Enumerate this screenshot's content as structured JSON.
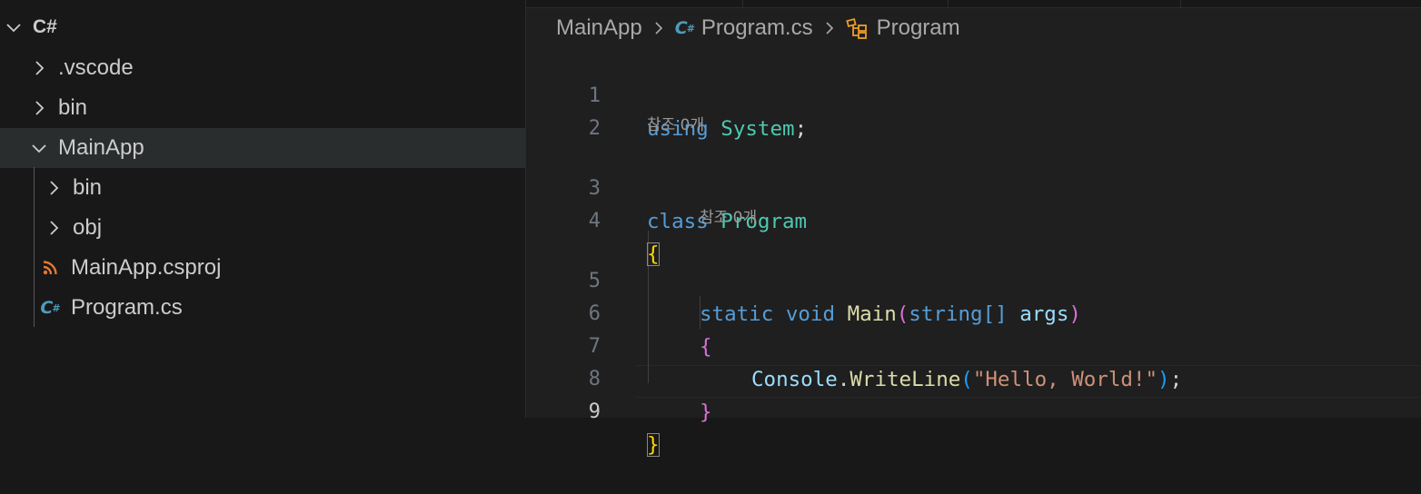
{
  "explorer": {
    "root": "C#",
    "items": [
      {
        "label": ".vscode",
        "kind": "folder",
        "expanded": false
      },
      {
        "label": "bin",
        "kind": "folder",
        "expanded": false
      },
      {
        "label": "MainApp",
        "kind": "folder",
        "expanded": true,
        "selected": true
      },
      {
        "label": "bin",
        "kind": "folder",
        "expanded": false
      },
      {
        "label": "obj",
        "kind": "folder",
        "expanded": false
      },
      {
        "label": "MainApp.csproj",
        "kind": "file",
        "icon": "rss-icon"
      },
      {
        "label": "Program.cs",
        "kind": "file",
        "icon": "csharp-icon",
        "icon_text": "C#"
      }
    ]
  },
  "breadcrumb": {
    "folder": "MainApp",
    "file": "Program.cs",
    "symbol": "Program",
    "file_icon_text": "C#"
  },
  "editor": {
    "line_numbers": [
      "1",
      "2",
      "3",
      "4",
      "5",
      "6",
      "7",
      "8",
      "9"
    ],
    "active_line": "9",
    "codelens": [
      "참조 0개",
      "참조 0개"
    ],
    "tokens": {
      "l1_kw": "using",
      "l1_ns": "System",
      "l1_end": ";",
      "l3_kw": "class",
      "l3_ty": "Program",
      "l4_br": "{",
      "l5_kw1": "static",
      "l5_kw2": "void",
      "l5_fn": "Main",
      "l5_open": "(",
      "l5_kw3": "string[]",
      "l5_var": "args",
      "l5_close": ")",
      "l6_br": "{",
      "l7_var": "Console",
      "l7_dot": ".",
      "l7_fn": "WriteLine",
      "l7_open": "(",
      "l7_str": "\"Hello, World!\"",
      "l7_close": ")",
      "l7_end": ";",
      "l8_br": "}",
      "l9_br": "}"
    }
  },
  "colors": {
    "keyword": "#569cd6",
    "type": "#4ec9b0",
    "function": "#dcdcaa",
    "variable": "#9cdcfe",
    "string": "#ce9178",
    "bracket_gold": "#ffd700",
    "bracket_purple": "#da70d6",
    "bracket_blue": "#179fff"
  }
}
